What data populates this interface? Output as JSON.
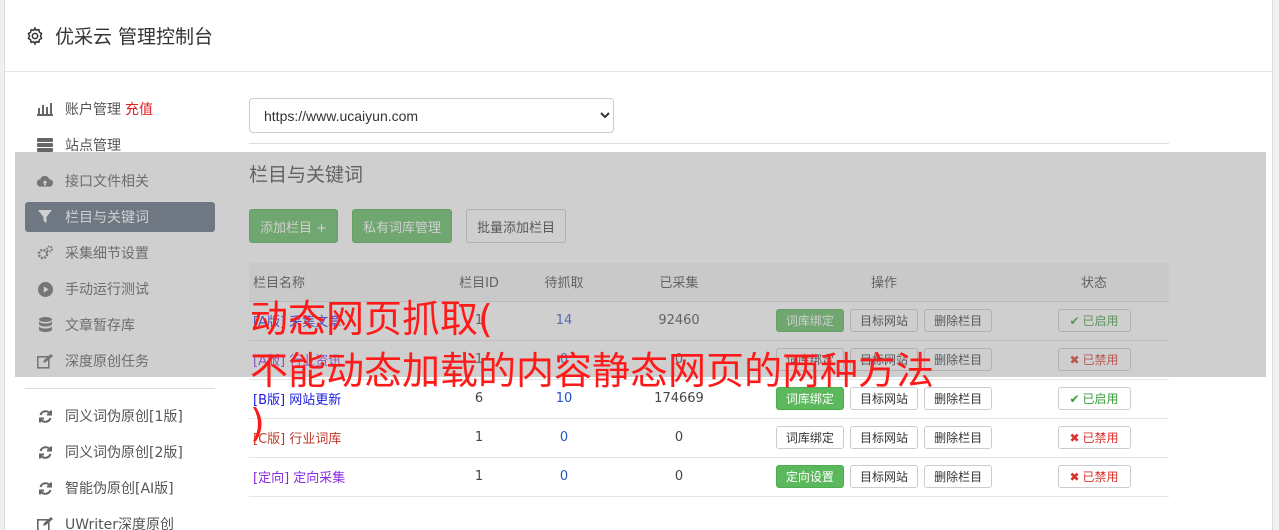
{
  "header": {
    "title": "优采云 管理控制台",
    "icon": "gear-icon"
  },
  "sidebar": {
    "items": [
      {
        "label": "账户管理",
        "extra": "充值",
        "icon": "bar-chart-icon",
        "active": false
      },
      {
        "label": "站点管理",
        "icon": "server-icon",
        "active": false
      },
      {
        "label": "接口文件相关",
        "icon": "cloud-upload-icon",
        "active": false
      },
      {
        "label": "栏目与关键词",
        "icon": "filter-icon",
        "active": true
      },
      {
        "label": "采集细节设置",
        "icon": "cogs-icon",
        "active": false
      },
      {
        "label": "手动运行测试",
        "icon": "play-circle-icon",
        "active": false
      },
      {
        "label": "文章暂存库",
        "icon": "database-icon",
        "active": false
      },
      {
        "label": "深度原创任务",
        "icon": "edit-icon",
        "active": false
      }
    ],
    "items2": [
      {
        "label": "同义词伪原创[1版]",
        "icon": "refresh-icon"
      },
      {
        "label": "同义词伪原创[2版]",
        "icon": "refresh-icon"
      },
      {
        "label": "智能伪原创[AI版]",
        "icon": "refresh-icon"
      },
      {
        "label": "UWriter深度原创",
        "icon": "edit-icon"
      }
    ]
  },
  "main": {
    "site_select": "https://www.ucaiyun.com",
    "section_title": "栏目与关键词",
    "buttons": {
      "add": "添加栏目 +",
      "private": "私有词库管理",
      "batch": "批量添加栏目"
    },
    "table": {
      "headers": {
        "name": "栏目名称",
        "id": "栏目ID",
        "pending": "待抓取",
        "collected": "已采集",
        "ops": "操作",
        "status": "状态"
      },
      "rows": [
        {
          "tag": "[A版]",
          "name": "采集文章",
          "id": "1",
          "pending": "14",
          "collected": "92460",
          "op1": "词库绑定",
          "op2": "目标网站",
          "op3": "删除栏目",
          "status": "已启用",
          "enabled": true,
          "op1_green": true
        },
        {
          "tag": "[A版]",
          "name": "行业资讯",
          "id": "1",
          "pending": "0",
          "collected": "0",
          "op1": "词库绑定",
          "op2": "目标网站",
          "op3": "删除栏目",
          "status": "已禁用",
          "enabled": false,
          "op1_green": false
        },
        {
          "tag": "[B版]",
          "name": "网站更新",
          "id": "6",
          "pending": "10",
          "collected": "174669",
          "op1": "词库绑定",
          "op2": "目标网站",
          "op3": "删除栏目",
          "status": "已启用",
          "enabled": true,
          "op1_green": true
        },
        {
          "tag": "[C版]",
          "name": "行业词库",
          "id": "1",
          "pending": "0",
          "collected": "0",
          "op1": "词库绑定",
          "op2": "目标网站",
          "op3": "删除栏目",
          "status": "已禁用",
          "enabled": false,
          "op1_green": false
        },
        {
          "tag": "[定向]",
          "name": "定向采集",
          "id": "1",
          "pending": "0",
          "collected": "0",
          "op1": "定向设置",
          "op2": "目标网站",
          "op3": "删除栏目",
          "status": "已禁用",
          "enabled": false,
          "op1_green": true
        }
      ]
    }
  },
  "overlay": {
    "line1": "动态网页抓取(",
    "line2": "不能动态加载的内容静态网页的两种方法",
    "line3": ")"
  }
}
